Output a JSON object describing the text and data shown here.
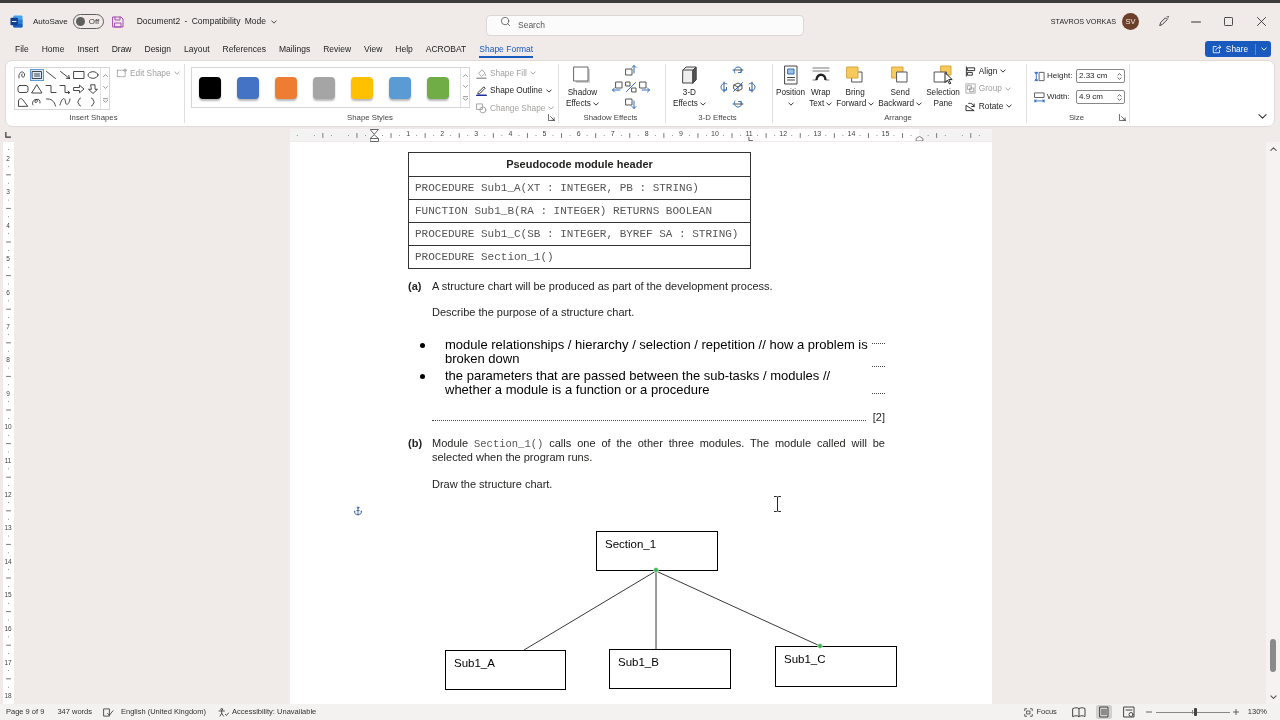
{
  "title_bar": {
    "autosave": {
      "label": "AutoSave",
      "state_label": "Off",
      "on": false
    },
    "document_title": "Document2 - Compatibility Mode",
    "search": {
      "placeholder": "Search"
    },
    "user": {
      "name": "STAVROS VORKAS",
      "initials": "SV"
    }
  },
  "menu_tabs": [
    {
      "label": "File",
      "selected": false
    },
    {
      "label": "Home",
      "selected": false
    },
    {
      "label": "Insert",
      "selected": false
    },
    {
      "label": "Draw",
      "selected": false
    },
    {
      "label": "Design",
      "selected": false
    },
    {
      "label": "Layout",
      "selected": false
    },
    {
      "label": "References",
      "selected": false
    },
    {
      "label": "Mailings",
      "selected": false
    },
    {
      "label": "Review",
      "selected": false
    },
    {
      "label": "View",
      "selected": false
    },
    {
      "label": "Help",
      "selected": false
    },
    {
      "label": "ACROBAT",
      "selected": false
    },
    {
      "label": "Shape Format",
      "selected": true
    }
  ],
  "share_button": {
    "label": "Share"
  },
  "ribbon": {
    "groups": [
      {
        "kind": "insert_shapes",
        "label": "Insert Shapes",
        "shapes": [
          {
            "kind": "curve-loop",
            "selected": false
          },
          {
            "kind": "text-box",
            "selected": true
          },
          {
            "kind": "line",
            "selected": false
          },
          {
            "kind": "arrow",
            "selected": false
          },
          {
            "kind": "rectangle",
            "selected": false
          },
          {
            "kind": "oval",
            "selected": false
          },
          {
            "kind": "rounded-rectangle",
            "selected": false
          },
          {
            "kind": "triangle",
            "selected": false
          },
          {
            "kind": "elbow-connector",
            "selected": false
          },
          {
            "kind": "elbow-arrow",
            "selected": false
          },
          {
            "kind": "right-arrow",
            "selected": false
          },
          {
            "kind": "down-arrow",
            "selected": false
          },
          {
            "kind": "freeform",
            "selected": false
          },
          {
            "kind": "scribble",
            "selected": false
          },
          {
            "kind": "arc",
            "selected": false
          },
          {
            "kind": "curve",
            "selected": false
          },
          {
            "kind": "left-brace",
            "selected": false
          },
          {
            "kind": "right-brace",
            "selected": false
          }
        ],
        "commands": [
          {
            "kind": "edit_shape",
            "label": "Edit Shape",
            "disabled": true
          }
        ]
      },
      {
        "kind": "shape_styles",
        "label": "Shape Styles",
        "dialog_launcher": true,
        "swatches": [
          {
            "color": "#000000"
          },
          {
            "color": "#4472c4"
          },
          {
            "color": "#ed7d31"
          },
          {
            "color": "#a5a5a5"
          },
          {
            "color": "#ffc000"
          },
          {
            "color": "#5b9bd5"
          },
          {
            "color": "#70ad47"
          }
        ],
        "commands": [
          {
            "kind": "shape_fill",
            "label": "Shape Fill",
            "disabled": true
          },
          {
            "kind": "shape_outline",
            "label": "Shape Outline",
            "disabled": false
          },
          {
            "kind": "change_shape",
            "label": "Change Shape",
            "disabled": true
          }
        ]
      },
      {
        "kind": "shadow_effects",
        "label": "Shadow Effects",
        "buttons": [
          {
            "kind": "shadow_effects",
            "lines": [
              "Shadow",
              "Effects"
            ],
            "dropdown": true
          }
        ]
      },
      {
        "kind": "three_d",
        "label": "3-D Effects",
        "buttons": [
          {
            "kind": "three_d",
            "lines": [
              "3-D",
              "Effects"
            ],
            "dropdown": true
          }
        ]
      },
      {
        "kind": "arrange",
        "label": "Arrange",
        "buttons": [
          {
            "kind": "position",
            "lines": [
              "Position"
            ],
            "dropdown": true
          },
          {
            "kind": "wrap_text",
            "lines": [
              "Wrap",
              "Text"
            ],
            "dropdown": true
          },
          {
            "kind": "bring_forward",
            "lines": [
              "Bring",
              "Forward"
            ],
            "dropdown": true
          },
          {
            "kind": "send_backward",
            "lines": [
              "Send",
              "Backward"
            ],
            "dropdown": true
          },
          {
            "kind": "selection_pane",
            "lines": [
              "Selection",
              "Pane"
            ],
            "dropdown": false
          }
        ],
        "commands": [
          {
            "kind": "align",
            "label": "Align",
            "disabled": false
          },
          {
            "kind": "group",
            "label": "Group",
            "disabled": true
          },
          {
            "kind": "rotate",
            "label": "Rotate",
            "disabled": false
          }
        ]
      },
      {
        "kind": "size",
        "label": "Size",
        "dialog_launcher": true,
        "fields": [
          {
            "kind": "height",
            "label": "Height:",
            "value": "2.33 cm"
          },
          {
            "kind": "width",
            "label": "Width:",
            "value": "4.9 cm"
          }
        ]
      }
    ]
  },
  "ruler": {
    "horizontal_labels": [
      "1",
      "2",
      "3",
      "4",
      "5",
      "6",
      "7",
      "8",
      "9",
      "10",
      "11",
      "12",
      "13",
      "14",
      "15"
    ],
    "vertical_labels": [
      "2",
      "3",
      "4",
      "5",
      "6",
      "7",
      "8",
      "9",
      "10",
      "11",
      "12",
      "13",
      "14",
      "15",
      "16",
      "17",
      "18"
    ]
  },
  "document": {
    "table": {
      "header": "Pseudocode module header",
      "rows": [
        "PROCEDURE Sub1_A(XT : INTEGER, PB : STRING)",
        "FUNCTION Sub1_B(RA : INTEGER) RETURNS BOOLEAN",
        "PROCEDURE Sub1_C(SB : INTEGER, BYREF SA : STRING)",
        "PROCEDURE Section_1()"
      ]
    },
    "part_a": {
      "label": "(a)",
      "stem": "A structure chart will be produced as part of the development process.",
      "task": "Describe the purpose of a structure chart.",
      "answer_bullets": [
        "module relationships / hierarchy / selection / repetition // how a problem is broken down",
        "the parameters that are passed between the sub-tasks / modules // whether a module is a function or a procedure"
      ],
      "marks": "[2]"
    },
    "part_b": {
      "label": "(b)",
      "stem_parts": [
        {
          "kind": "text",
          "text": "Module"
        },
        {
          "kind": "code",
          "text": "Section_1()"
        },
        {
          "kind": "text",
          "text": "calls one of the other three modules. The module called will be selected when the program runs."
        }
      ],
      "task": "Draw the structure chart."
    },
    "structure_chart": {
      "root": {
        "label": "Section_1"
      },
      "children": [
        {
          "label": "Sub1_A",
          "connector_selected": false
        },
        {
          "label": "Sub1_B",
          "connector_selected": false
        },
        {
          "label": "Sub1_C",
          "connector_selected": true
        }
      ]
    }
  },
  "status_bar": {
    "page": "Page 9 of 9",
    "words": "347 words",
    "language": "English (United Kingdom)",
    "accessibility": "Accessibility: Unavailable",
    "focus": "Focus",
    "view_buttons": [
      {
        "kind": "read",
        "selected": false
      },
      {
        "kind": "print",
        "selected": true
      },
      {
        "kind": "web",
        "selected": false
      }
    ],
    "zoom": {
      "level": 0.54,
      "label": "130%"
    }
  }
}
